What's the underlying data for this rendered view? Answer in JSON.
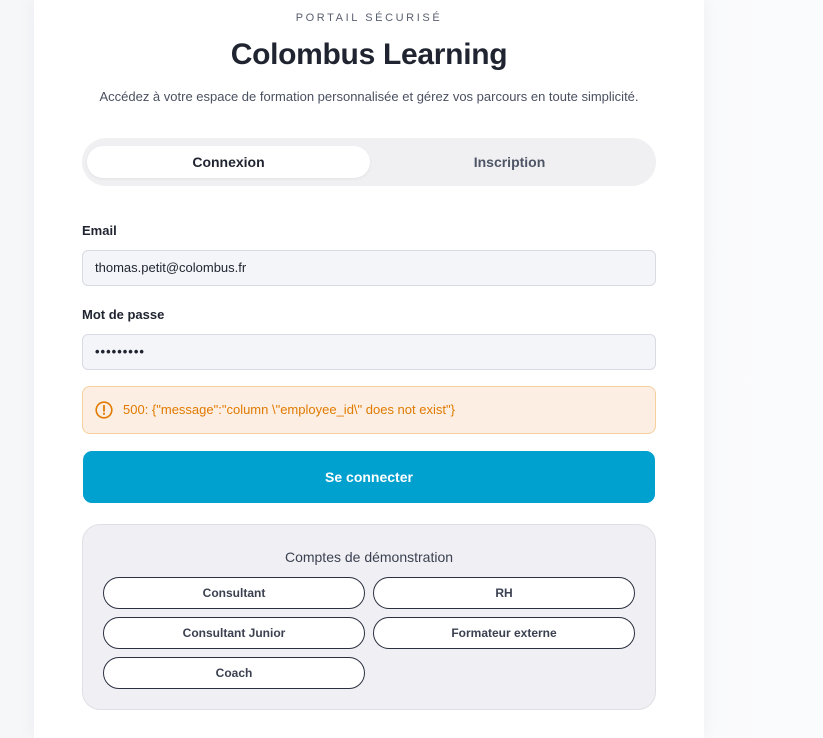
{
  "header": {
    "eyebrow": "PORTAIL SÉCURISÉ",
    "title": "Colombus Learning",
    "subtitle": "Accédez à votre espace de formation personnalisée et gérez vos parcours en toute simplicité."
  },
  "tabs": [
    {
      "label": "Connexion",
      "active": true
    },
    {
      "label": "Inscription",
      "active": false
    }
  ],
  "form": {
    "email_label": "Email",
    "email_value": "thomas.petit@colombus.fr",
    "password_label": "Mot de passe",
    "password_mask": "•••••••••"
  },
  "error": {
    "icon": "alert-circle-icon",
    "message": "500: {\"message\":\"column \\\"employee_id\\\" does not exist\"}"
  },
  "submit_label": "Se connecter",
  "demo": {
    "title": "Comptes de démonstration",
    "accounts": [
      "Consultant",
      "RH",
      "Consultant Junior",
      "Formateur externe",
      "Coach"
    ]
  },
  "colors": {
    "accent": "#00a0cf",
    "error_text": "#e07a00",
    "error_bg": "#fdeee3"
  }
}
